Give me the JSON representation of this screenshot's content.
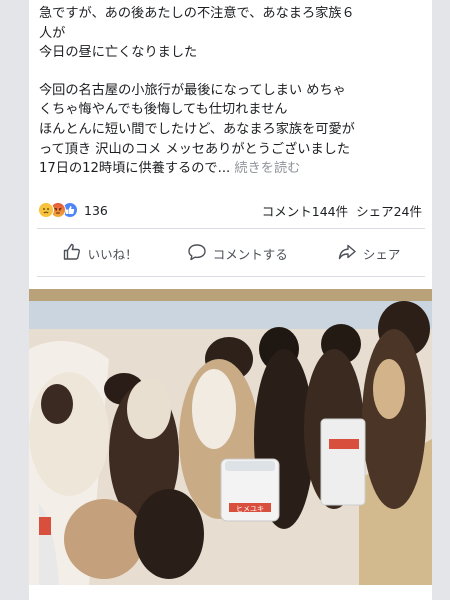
{
  "post": {
    "lines": [
      "急ですが、あの後あたしの不注意で、あなまろ家族６",
      "人が",
      "今日の昼に亡くなりました",
      "今回の名古屋の小旅行が最後になってしまい めちゃ",
      "くちゃ悔やんでも後悔しても仕切れません",
      "ほんとんに短い間でしたけど、あなまろ家族を可愛が",
      "って頂き 沢山のコメ メッセありがとうございました",
      "17日の12時頃に供養するので..."
    ],
    "see_more": "続きを読む"
  },
  "stats": {
    "reaction_count": "136",
    "comments": "コメント144件",
    "shares": "シェア24件"
  },
  "actions": {
    "like": "いいね！",
    "comment": "コメントする",
    "share": "シェア"
  },
  "photo": {
    "cup_label": "ヒメユキ"
  },
  "icons": {
    "reactions": [
      "sad-icon",
      "angry-icon",
      "like-icon"
    ],
    "like": "thumb-up-icon",
    "comment": "speech-bubble-icon",
    "share": "share-arrow-icon"
  },
  "colors": {
    "background": "#e4e5e9",
    "card": "#ffffff",
    "text": "#1c1e21",
    "muted": "#90949c",
    "like_blue": "#4e85f7"
  }
}
